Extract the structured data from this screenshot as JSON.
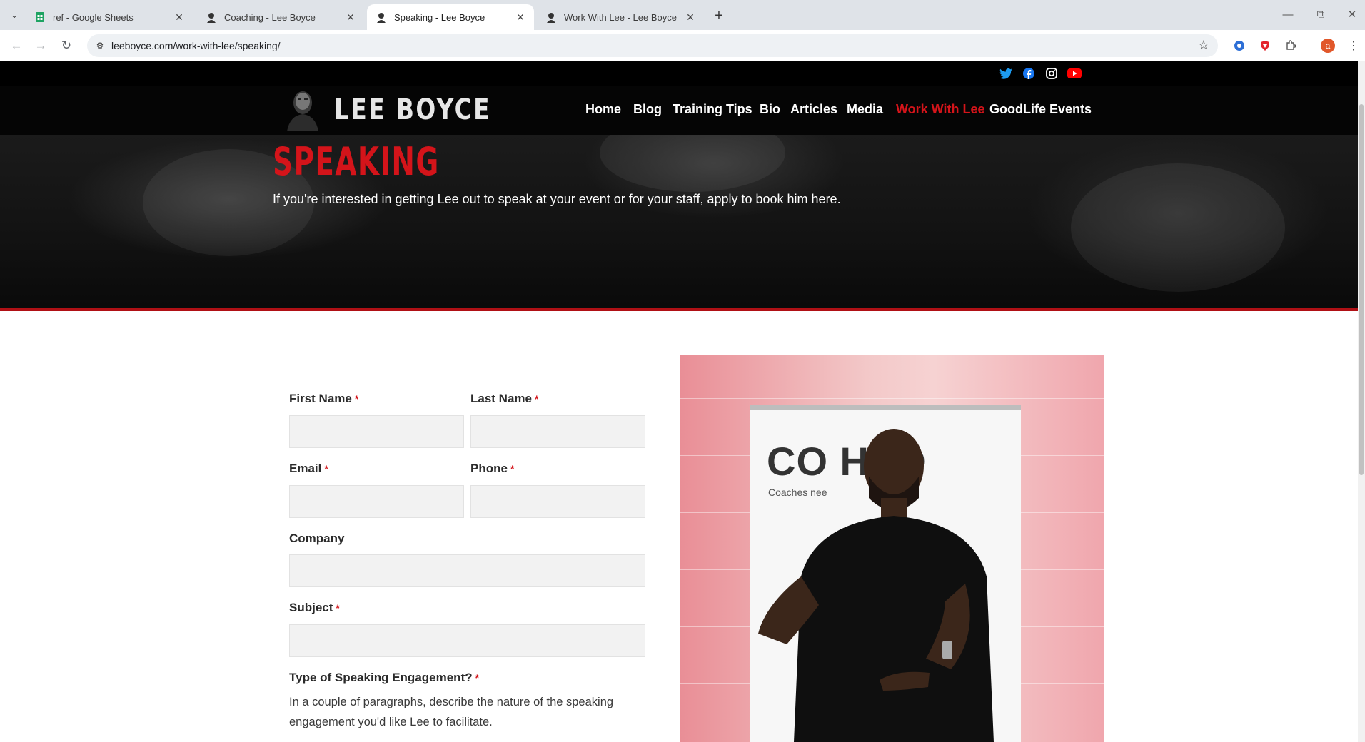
{
  "browser": {
    "tabs": [
      {
        "title": "ref - Google Sheets",
        "icon": "sheets-icon"
      },
      {
        "title": "Coaching - Lee Boyce",
        "icon": "lee-boyce-favicon"
      },
      {
        "title": "Speaking - Lee Boyce",
        "icon": "lee-boyce-favicon",
        "active": true
      },
      {
        "title": "Work With Lee - Lee Boyce",
        "icon": "lee-boyce-favicon"
      }
    ],
    "url": "leeboyce.com/work-with-lee/speaking/",
    "profile_initial": "a"
  },
  "site": {
    "logo_text": "LEE BOYCE",
    "nav": [
      {
        "label": "Home"
      },
      {
        "label": "Blog"
      },
      {
        "label": "Training Tips"
      },
      {
        "label": "Bio"
      },
      {
        "label": "Articles"
      },
      {
        "label": "Media"
      },
      {
        "label": "Work With Lee",
        "active": true
      },
      {
        "label": "GoodLife Events"
      }
    ],
    "social": [
      "twitter-icon",
      "facebook-icon",
      "instagram-icon",
      "youtube-icon"
    ],
    "hero": {
      "title": "SPEAKING",
      "subtitle": "If you're interested in getting Lee out to speak at your event or for your staff, apply to book him here."
    },
    "form": {
      "required_mark": "*",
      "first_name": "First Name",
      "last_name": "Last Name",
      "email": "Email",
      "phone": "Phone",
      "company": "Company",
      "subject": "Subject",
      "engagement_type": "Type of Speaking Engagement?",
      "engagement_desc": "In a couple of paragraphs, describe the nature of the speaking engagement you'd like Lee to facilitate."
    },
    "photo": {
      "banner_text": "CO  HED",
      "banner_sub": "Coaches nee"
    }
  },
  "colors": {
    "accent_red": "#d4141a",
    "nav_bg": "#050505"
  }
}
